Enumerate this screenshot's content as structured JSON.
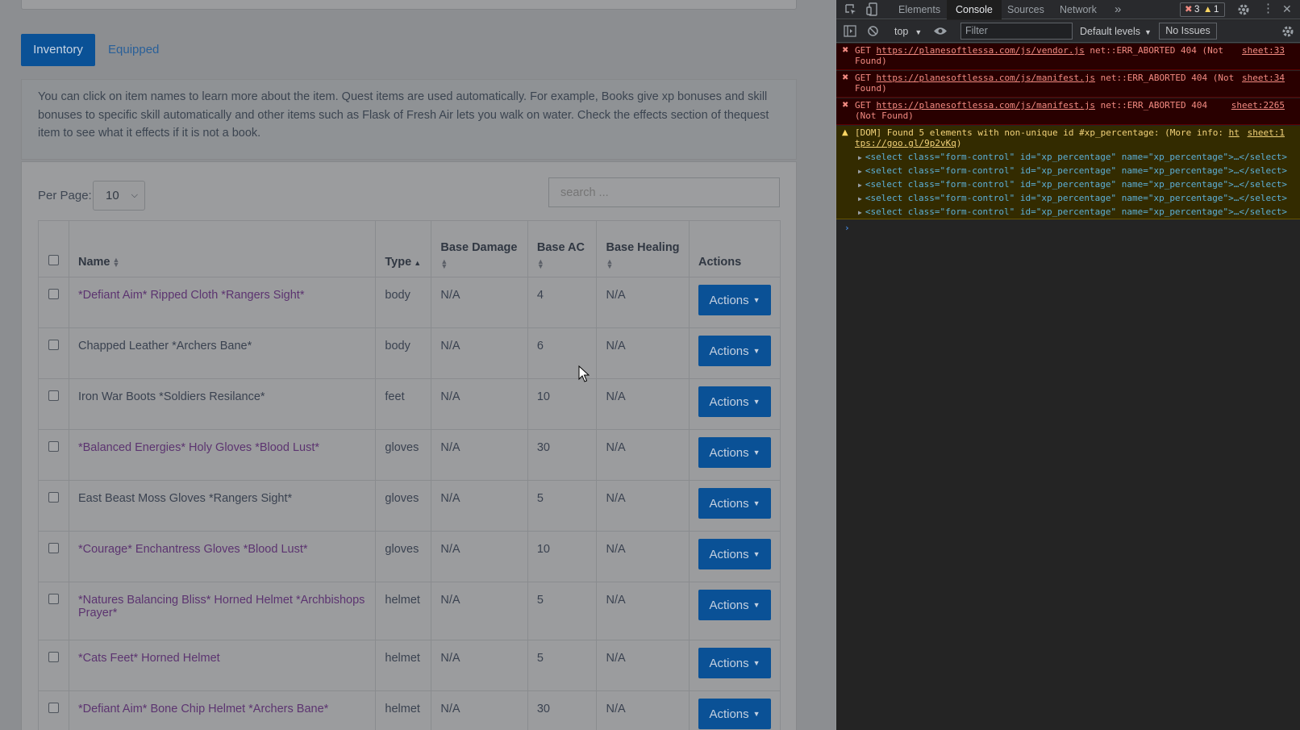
{
  "tabs": {
    "inventory": "Inventory",
    "equipped": "Equipped"
  },
  "info_text": "You can click on item names to learn more about the item. Quest items are used automatically. For example, Books give xp bonuses and skill bonuses to specific skill automatically and other items such as Flask of Fresh Air lets you walk on water. Check the effects section of thequest item to see what it effects if it is not a book.",
  "per_page": {
    "label": "Per Page:",
    "value": "10"
  },
  "search": {
    "placeholder": "search ..."
  },
  "table": {
    "headers": {
      "name": "Name",
      "type": "Type",
      "base_damage": "Base Damage",
      "base_ac": "Base AC",
      "base_healing": "Base Healing",
      "actions": "Actions"
    },
    "rows": [
      {
        "name": "*Defiant Aim* Ripped Cloth *Rangers Sight*",
        "type": "body",
        "damage": "N/A",
        "ac": "4",
        "healing": "N/A",
        "action": "Actions"
      },
      {
        "name": "Chapped Leather *Archers Bane*",
        "type": "body",
        "damage": "N/A",
        "ac": "6",
        "healing": "N/A",
        "action": "Actions"
      },
      {
        "name": "Iron War Boots *Soldiers Resilance*",
        "type": "feet",
        "damage": "N/A",
        "ac": "10",
        "healing": "N/A",
        "action": "Actions"
      },
      {
        "name": "*Balanced Energies* Holy Gloves *Blood Lust*",
        "type": "gloves",
        "damage": "N/A",
        "ac": "30",
        "healing": "N/A",
        "action": "Actions"
      },
      {
        "name": "East Beast Moss Gloves *Rangers Sight*",
        "type": "gloves",
        "damage": "N/A",
        "ac": "5",
        "healing": "N/A",
        "action": "Actions"
      },
      {
        "name": "*Courage* Enchantress Gloves *Blood Lust*",
        "type": "gloves",
        "damage": "N/A",
        "ac": "10",
        "healing": "N/A",
        "action": "Actions"
      },
      {
        "name": "*Natures Balancing Bliss* Horned Helmet *Archbishops Prayer*",
        "type": "helmet",
        "damage": "N/A",
        "ac": "5",
        "healing": "N/A",
        "action": "Actions"
      },
      {
        "name": "*Cats Feet* Horned Helmet",
        "type": "helmet",
        "damage": "N/A",
        "ac": "5",
        "healing": "N/A",
        "action": "Actions"
      },
      {
        "name": "*Defiant Aim* Bone Chip Helmet *Archers Bane*",
        "type": "helmet",
        "damage": "N/A",
        "ac": "30",
        "healing": "N/A",
        "action": "Actions"
      }
    ]
  },
  "devtools": {
    "tabs": {
      "elements": "Elements",
      "console": "Console",
      "sources": "Sources",
      "network": "Network",
      "more": "»"
    },
    "error_count": "3",
    "warning_count": "1",
    "context": "top",
    "filter_placeholder": "Filter",
    "levels": "Default levels",
    "issues": "No Issues",
    "messages": {
      "e1_pre": "GET ",
      "e1_url": "https://planesoftlessa.com/js/vendor.js",
      "e1_post": " net::ERR_ABORTED 404 (Not",
      "e1_cont": "Found)",
      "e1_src": "sheet:33",
      "e2_pre": "GET ",
      "e2_url": "https://planesoftlessa.com/js/manifest.js",
      "e2_post": " net::ERR_ABORTED 404 (Not",
      "e2_cont": "Found)",
      "e2_src": "sheet:34",
      "e3_pre": "GET ",
      "e3_url": "https://planesoftlessa.com/js/manifest.js",
      "e3_post": " net::ERR_ABORTED 404",
      "e3_cont": "(Not Found)",
      "e3_src": "sheet:2265",
      "w_text": "[DOM] Found 5 elements with non-unique id #xp_percentage: (More info: ",
      "w_link1": "ht",
      "w_link2": "tps://goo.gl/9p2vKq",
      "w_close": ")",
      "w_src": "sheet:1",
      "w_nodes": [
        "<select class=\"form-control\" id=\"xp_percentage\" name=\"xp_percentage\">…</select>",
        "<select class=\"form-control\" id=\"xp_percentage\" name=\"xp_percentage\">…</select>",
        "<select class=\"form-control\" id=\"xp_percentage\" name=\"xp_percentage\">…</select>",
        "<select class=\"form-control\" id=\"xp_percentage\" name=\"xp_percentage\">…</select>",
        "<select class=\"form-control\" id=\"xp_percentage\" name=\"xp_percentage\">…</select>"
      ],
      "prompt": "›"
    }
  }
}
